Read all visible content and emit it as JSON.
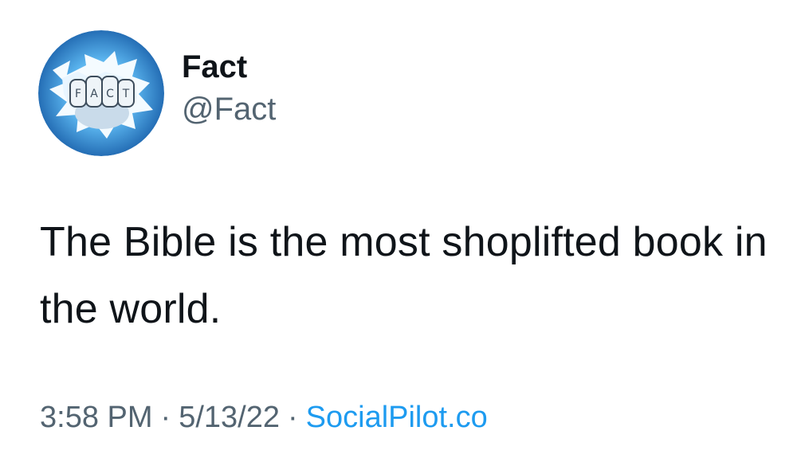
{
  "user": {
    "display_name": "Fact",
    "handle": "@Fact",
    "avatar_icon": "fact-fist-logo-icon",
    "avatar_logo_text": "FACT"
  },
  "tweet": {
    "text": "The Bible is the most shoplifted book in the world."
  },
  "meta": {
    "time": "3:58 PM",
    "separator": "·",
    "date": "5/13/22",
    "source": "SocialPilot.co"
  },
  "colors": {
    "text_primary": "#0f1419",
    "text_secondary": "#536471",
    "link": "#1d9bf0",
    "avatar_blue": "#1e88d8"
  }
}
